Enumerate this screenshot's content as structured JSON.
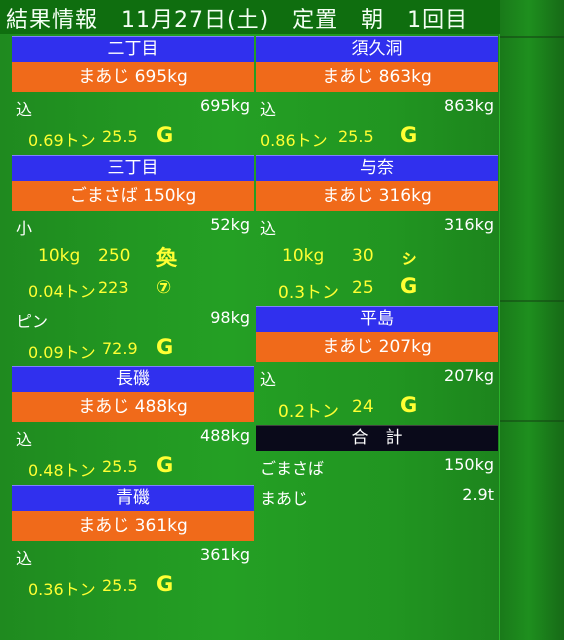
{
  "title": "結果情報　11月27日(土)　定置　朝　1回目",
  "left": [
    {
      "name": "二丁目",
      "fish": "まあじ 695kg",
      "rows": [
        {
          "label": "込",
          "value": "695kg"
        }
      ],
      "details": [
        {
          "a": "0.69トン",
          "b": "25.5",
          "icon": "G"
        }
      ]
    },
    {
      "name": "三丁目",
      "fish": "ごまさば 150kg",
      "rows": [
        {
          "label": "小",
          "value": "52kg"
        }
      ],
      "details": [
        {
          "a": "10kg",
          "b": "250",
          "icon": "奐"
        },
        {
          "a": "0.04トン",
          "b": "223",
          "icon": "⑦"
        }
      ],
      "rows2": [
        {
          "label": "ピン",
          "value": "98kg"
        }
      ],
      "details2": [
        {
          "a": "0.09トン",
          "b": "72.9",
          "icon": "G"
        }
      ]
    },
    {
      "name": "長磯",
      "fish": "まあじ 488kg",
      "rows": [
        {
          "label": "込",
          "value": "488kg"
        }
      ],
      "details": [
        {
          "a": "0.48トン",
          "b": "25.5",
          "icon": "G"
        }
      ]
    },
    {
      "name": "青磯",
      "fish": "まあじ 361kg",
      "rows": [
        {
          "label": "込",
          "value": "361kg"
        }
      ],
      "details": [
        {
          "a": "0.36トン",
          "b": "25.5",
          "icon": "G"
        }
      ]
    }
  ],
  "right": [
    {
      "name": "須久洞",
      "fish": "まあじ 863kg",
      "rows": [
        {
          "label": "込",
          "value": "863kg"
        }
      ],
      "details": [
        {
          "a": "0.86トン",
          "b": "25.5",
          "icon": "G"
        }
      ]
    },
    {
      "name": "与奈",
      "fish": "まあじ 316kg",
      "rows": [
        {
          "label": "込",
          "value": "316kg"
        }
      ],
      "details": [
        {
          "a": "10kg",
          "b": "30",
          "icon": "ㇱ"
        },
        {
          "a": "0.3トン",
          "b": "25",
          "icon": "G"
        }
      ]
    },
    {
      "name": "平島",
      "fish": "まあじ 207kg",
      "rows": [
        {
          "label": "込",
          "value": "207kg"
        }
      ],
      "details": [
        {
          "a": "0.2トン",
          "b": "24",
          "icon": "G"
        }
      ]
    }
  ],
  "total": {
    "header": "合　計",
    "rows": [
      {
        "label": "ごまさば",
        "value": "150kg"
      },
      {
        "label": "まあじ",
        "value": "2.9t"
      }
    ]
  },
  "colors": {
    "blue": "#3030ee",
    "orange": "#f06a1a",
    "green": "#24a024",
    "yellow": "#ffff33"
  }
}
